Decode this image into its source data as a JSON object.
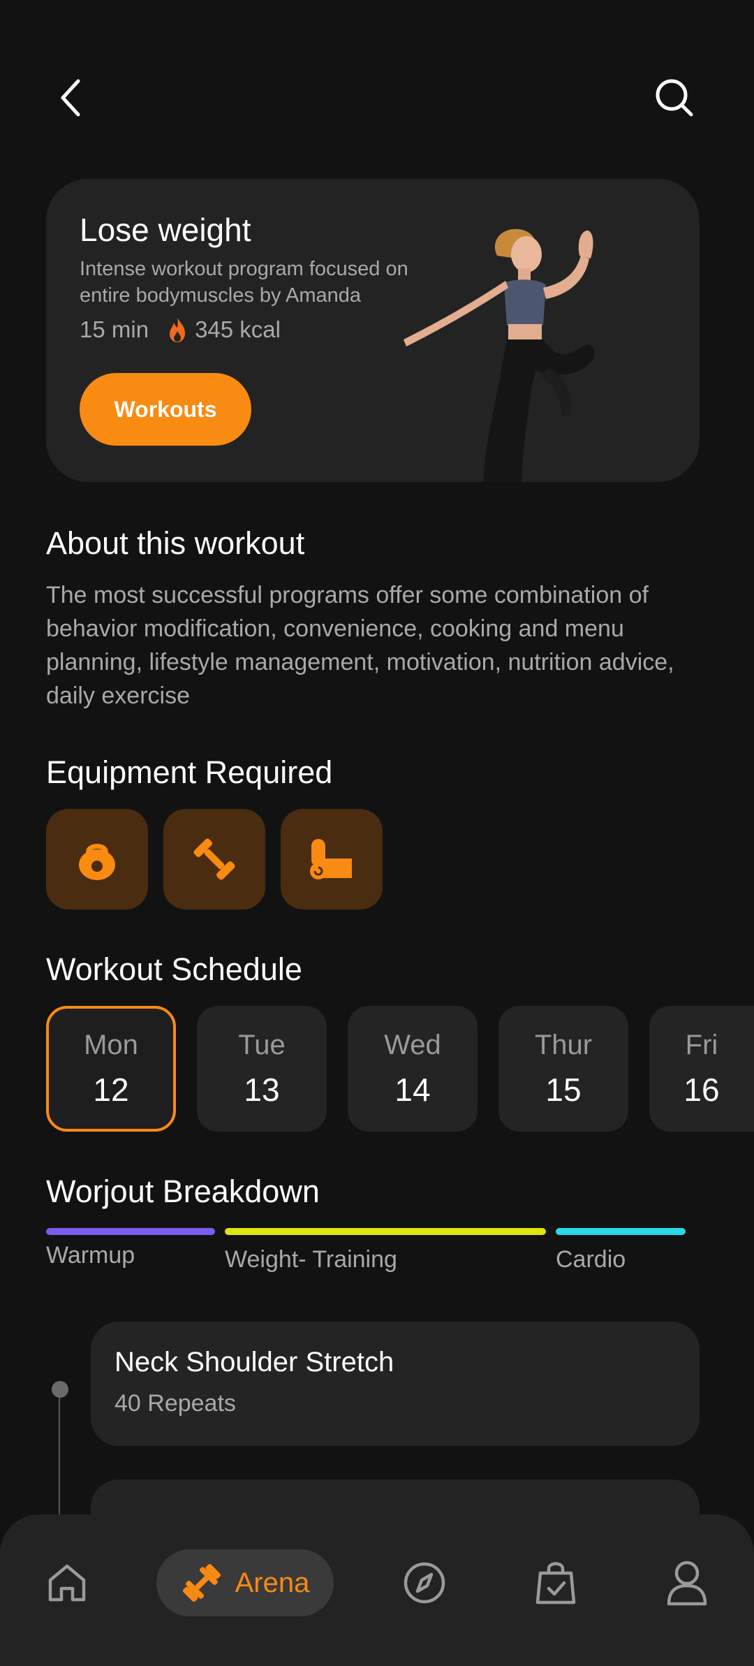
{
  "top_bar": {
    "back_icon": "chevron-left-icon",
    "search_icon": "search-icon"
  },
  "hero": {
    "title": "Lose weight",
    "description": "Intense workout program focused on entire bodymuscles by Amanda",
    "duration": "15 min",
    "calories": "345 kcal",
    "button_label": "Workouts"
  },
  "about": {
    "heading": "About this workout",
    "text": "The most successful programs offer some combination of behavior modification, convenience, cooking and menu planning, lifestyle management, motivation, nutrition advice, daily exercise"
  },
  "equipment": {
    "heading": "Equipment Required",
    "items": [
      "kettlebell-icon",
      "dumbbell-icon",
      "yoga-mat-icon"
    ]
  },
  "schedule": {
    "heading": "Workout Schedule",
    "days": [
      {
        "name": "Mon",
        "num": "12"
      },
      {
        "name": "Tue",
        "num": "13"
      },
      {
        "name": "Wed",
        "num": "14"
      },
      {
        "name": "Thur",
        "num": "15"
      },
      {
        "name": "Fri",
        "num": "16"
      }
    ]
  },
  "breakdown": {
    "heading": "Worjout Breakdown",
    "segments": [
      {
        "label": "Warmup",
        "color": "#7b5cf0"
      },
      {
        "label": "Weight- Training",
        "color": "#dfe50f"
      },
      {
        "label": "Cardio",
        "color": "#2ad8e6"
      }
    ]
  },
  "exercises": [
    {
      "title": "Neck Shoulder Stretch",
      "subtitle": "40 Repeats"
    }
  ],
  "nav": {
    "active_label": "Arena",
    "accent": "#f98a12",
    "items": [
      "home-icon",
      "dumbbell-icon",
      "compass-icon",
      "shopping-bag-icon",
      "profile-icon"
    ]
  }
}
